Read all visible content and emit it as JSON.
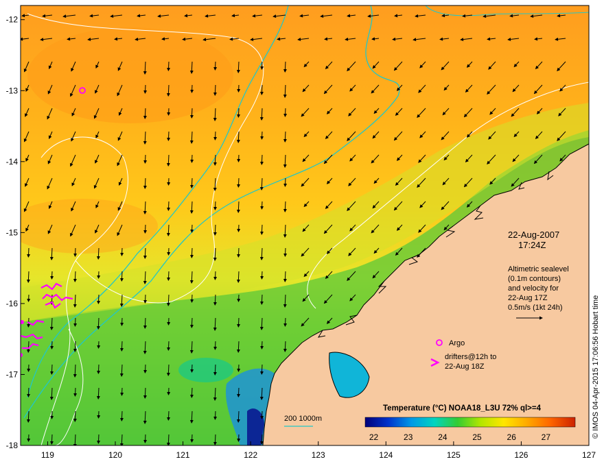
{
  "map": {
    "lon_ticks": [
      "119",
      "120",
      "121",
      "122",
      "123",
      "124",
      "125",
      "126",
      "127"
    ],
    "lat_ticks": [
      "-12",
      "-13",
      "-14",
      "-15",
      "-16",
      "-17",
      "-18"
    ],
    "lon_range": [
      118.6,
      127.0
    ],
    "lat_range": [
      -18.0,
      -11.8
    ]
  },
  "annotations": {
    "date": "22-Aug-2007",
    "time": "17:24Z",
    "altimetry_lines": [
      "Altimetric sealevel",
      "(0.1m contours)",
      "and velocity for",
      "22-Aug 17Z",
      "0.5m/s (1kt 24h)"
    ],
    "argo_label": "Argo",
    "drifters_lines": [
      "drifters@12h to",
      "22-Aug 18Z"
    ],
    "bathymetry_label": "200  1000m"
  },
  "colorbar": {
    "title": "Temperature (°C) NOAA18_L3U 72% ql>=4",
    "ticks": [
      "22",
      "23",
      "24",
      "25",
      "26",
      "27"
    ],
    "min": 21.75,
    "max": 27.85,
    "colors": [
      "#00007a",
      "#0033cc",
      "#0099e6",
      "#00d4c0",
      "#33cc33",
      "#b3e600",
      "#ffe600",
      "#ffaa00",
      "#ff6600",
      "#cc2200"
    ]
  },
  "credit": "© IMOS 04-Apr-2015 17:06:56 Hobart time",
  "colors": {
    "land": "#f7c9a0",
    "argo": "#ff00ff",
    "bathy_200": "#21c7c7",
    "contour": "#ffffff"
  }
}
